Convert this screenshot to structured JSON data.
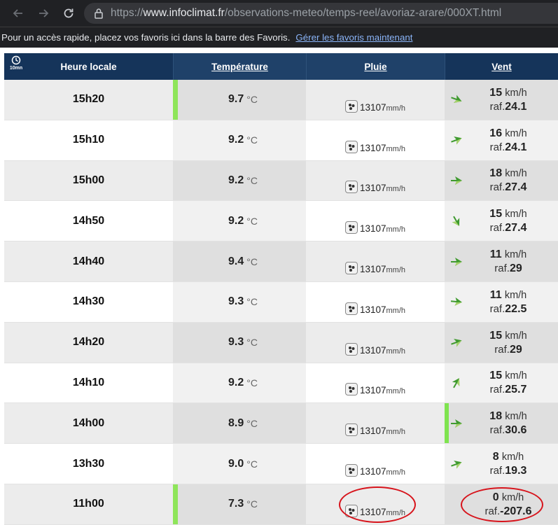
{
  "browser": {
    "url_prefix": "https://",
    "url_host": "www.infoclimat.fr",
    "url_path": "/observations-meteo/temps-reel/avoriaz-arare/000XT.html",
    "favorites_text": "Pour un accès rapide, placez vos favoris ici dans la barre des Favoris.",
    "favorites_link": "Gérer les favoris maintenant"
  },
  "table": {
    "clock_label": "10mn",
    "headers": {
      "time": "Heure locale",
      "temperature": "Température",
      "rain": "Pluie",
      "wind": "Vent"
    },
    "temp_unit": "°C",
    "rain_unit": "mm/h",
    "wind_unit": "km/h",
    "gust_prefix": "raf.",
    "rows": [
      {
        "time": "15h20",
        "temp": "9.7",
        "rain": "13107",
        "wind": "15",
        "gust": "24.1",
        "arrow_rotate": 200,
        "temp_bar": true,
        "wind_bar": false
      },
      {
        "time": "15h10",
        "temp": "9.2",
        "rain": "13107",
        "wind": "16",
        "gust": "24.1",
        "arrow_rotate": 160,
        "temp_bar": false,
        "wind_bar": false
      },
      {
        "time": "15h00",
        "temp": "9.2",
        "rain": "13107",
        "wind": "18",
        "gust": "27.4",
        "arrow_rotate": 180,
        "temp_bar": false,
        "wind_bar": false
      },
      {
        "time": "14h50",
        "temp": "9.2",
        "rain": "13107",
        "wind": "15",
        "gust": "27.4",
        "arrow_rotate": 240,
        "temp_bar": false,
        "wind_bar": false
      },
      {
        "time": "14h40",
        "temp": "9.4",
        "rain": "13107",
        "wind": "11",
        "gust": "29",
        "arrow_rotate": 180,
        "temp_bar": false,
        "wind_bar": false
      },
      {
        "time": "14h30",
        "temp": "9.3",
        "rain": "13107",
        "wind": "11",
        "gust": "22.5",
        "arrow_rotate": 185,
        "temp_bar": false,
        "wind_bar": false
      },
      {
        "time": "14h20",
        "temp": "9.3",
        "rain": "13107",
        "wind": "15",
        "gust": "29",
        "arrow_rotate": 160,
        "temp_bar": false,
        "wind_bar": false
      },
      {
        "time": "14h10",
        "temp": "9.2",
        "rain": "13107",
        "wind": "15",
        "gust": "25.7",
        "arrow_rotate": 120,
        "temp_bar": false,
        "wind_bar": false
      },
      {
        "time": "14h00",
        "temp": "8.9",
        "rain": "13107",
        "wind": "18",
        "gust": "30.6",
        "arrow_rotate": 180,
        "temp_bar": false,
        "wind_bar": true
      },
      {
        "time": "13h30",
        "temp": "9.0",
        "rain": "13107",
        "wind": "8",
        "gust": "19.3",
        "arrow_rotate": 160,
        "temp_bar": false,
        "wind_bar": false
      },
      {
        "time": "11h00",
        "temp": "7.3",
        "rain": "13107",
        "wind": "0",
        "gust": "-207.6",
        "arrow_rotate": null,
        "temp_bar": true,
        "wind_bar": false
      }
    ]
  },
  "colors": {
    "header_bg": "#1b3a5a",
    "temp_bar": "#8ee55a",
    "arrow_green": "#3f9a2f",
    "annotation_red": "#d7141c"
  }
}
